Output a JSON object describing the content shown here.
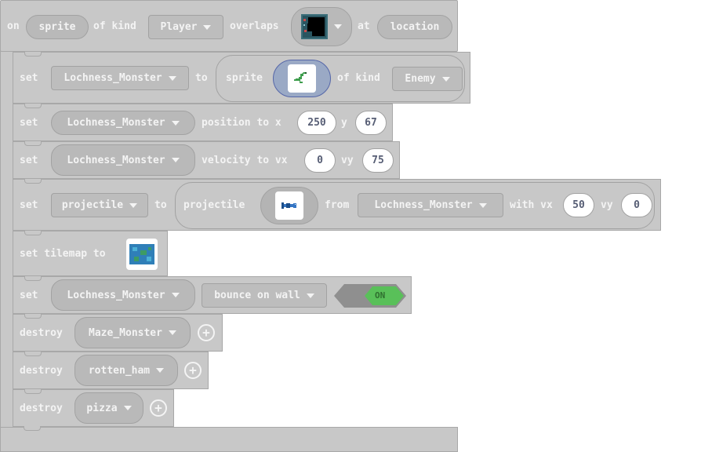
{
  "header": {
    "on": "on",
    "sprite_param": "sprite",
    "of_kind": "of kind",
    "kind_value": "Player",
    "overlaps": "overlaps",
    "tile_icon": "wall-tile-icon",
    "at": "at",
    "location_param": "location"
  },
  "rows": {
    "r1": {
      "set": "set",
      "var": "Lochness_Monster",
      "to": "to",
      "sprite": "sprite",
      "sprite_icon": "sea-serpent-sprite-icon",
      "of_kind": "of kind",
      "kind": "Enemy"
    },
    "r2": {
      "set": "set",
      "var": "Lochness_Monster",
      "position_to_x": "position to x",
      "x": "250",
      "y_label": "y",
      "y": "67"
    },
    "r3": {
      "set": "set",
      "var": "Lochness_Monster",
      "velocity_to_vx": "velocity to vx",
      "vx": "0",
      "vy_label": "vy",
      "vy": "75"
    },
    "r4": {
      "set": "set",
      "var": "projectile",
      "to": "to",
      "projectile": "projectile",
      "proj_icon": "fish-projectile-icon",
      "from": "from",
      "source": "Lochness_Monster",
      "with_vx": "with vx",
      "vx": "50",
      "vy_label": "vy",
      "vy": "0"
    },
    "r5": {
      "set_tilemap_to": "set tilemap to",
      "tilemap_icon": "tilemap-icon"
    },
    "r6": {
      "set": "set",
      "var": "Lochness_Monster",
      "flag": "bounce on wall",
      "toggle": "ON"
    },
    "r7": {
      "destroy": "destroy",
      "var": "Maze_Monster"
    },
    "r8": {
      "destroy": "destroy",
      "var": "rotten_ham"
    },
    "r9": {
      "destroy": "destroy",
      "var": "pizza"
    }
  },
  "colors": {
    "block": "#c8c8c8",
    "block_border": "#a8a8a8",
    "field": "#b9b9b9",
    "text": "#f4f4f4",
    "number_text": "#575e75",
    "toggle_on": "#59c059",
    "selected_outline": "#5566a8"
  }
}
